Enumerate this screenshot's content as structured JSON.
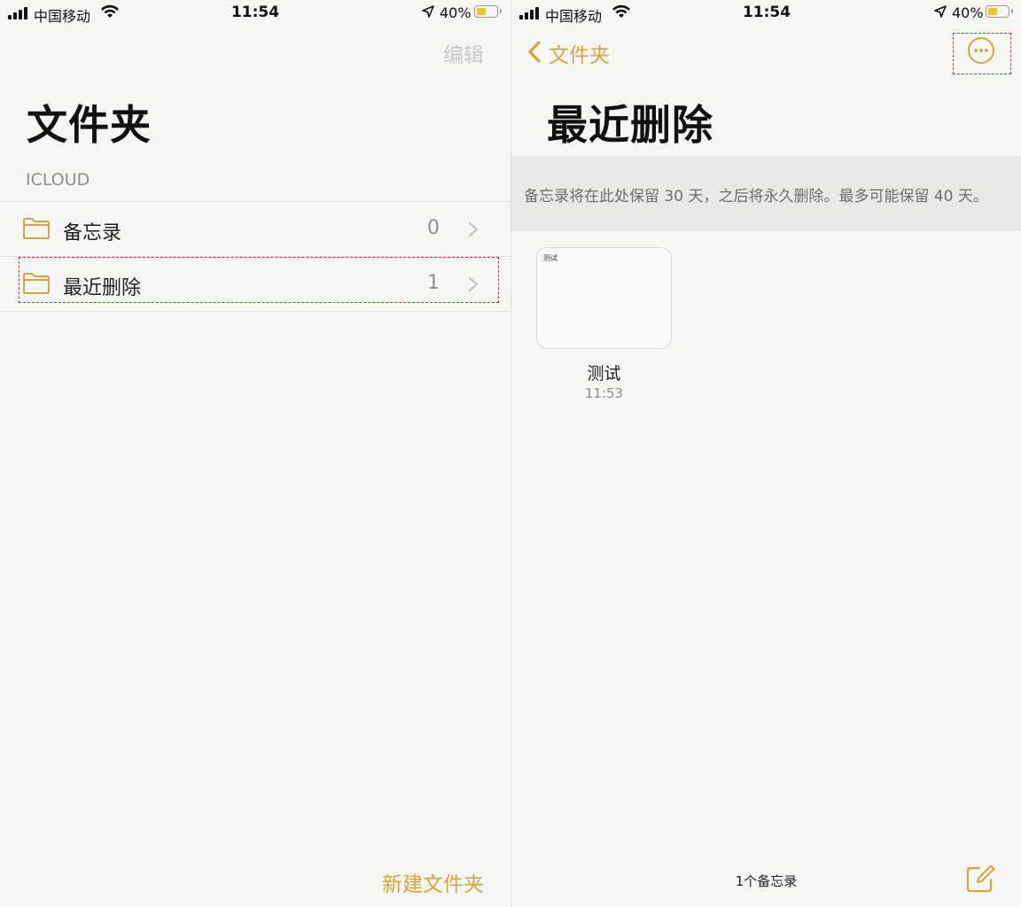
{
  "colors": {
    "accent": "#d9a53b",
    "highlight": "#e0322c",
    "battery": "#f5c518"
  },
  "left": {
    "status": {
      "carrier": "中国移动",
      "time": "11:54",
      "battery_pct": "40%"
    },
    "nav": {
      "edit_label": "编辑"
    },
    "title": "文件夹",
    "section": "ICLOUD",
    "folders": [
      {
        "label": "备忘录",
        "count": "0",
        "icon": "folder-icon"
      },
      {
        "label": "最近删除",
        "count": "1",
        "icon": "folder-icon"
      }
    ],
    "toolbar": {
      "new_folder_label": "新建文件夹"
    }
  },
  "right": {
    "status": {
      "carrier": "中国移动",
      "time": "11:54",
      "battery_pct": "40%"
    },
    "nav": {
      "back_label": "文件夹",
      "more_icon": "ellipsis-circle-icon"
    },
    "title": "最近删除",
    "banner": "备忘录将在此处保留 30 天，之后将永久删除。最多可能保留 40 天。",
    "notes": [
      {
        "preview": "测试",
        "title": "测试",
        "time": "11:53"
      }
    ],
    "toolbar": {
      "count_label": "1个备忘录",
      "compose_icon": "compose-icon"
    }
  }
}
